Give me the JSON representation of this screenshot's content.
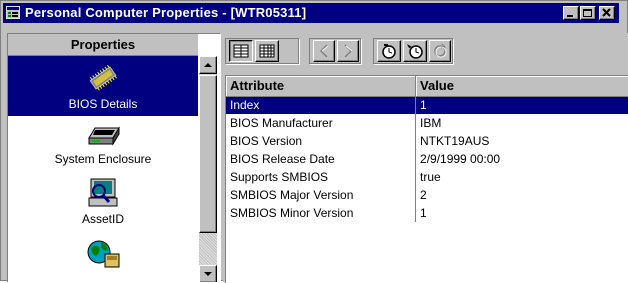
{
  "window": {
    "title": "Personal Computer Properties - [WTR05311]",
    "controls": {
      "minimize_icon": "minimize-icon",
      "maximize_icon": "maximize-icon",
      "close_icon": "close-icon"
    }
  },
  "sidebar": {
    "header": "Properties",
    "items": [
      {
        "label": "BIOS Details",
        "icon": "bios-chip-icon",
        "selected": true
      },
      {
        "label": "System Enclosure",
        "icon": "system-enclosure-icon",
        "selected": false
      },
      {
        "label": "AssetID",
        "icon": "asset-id-icon",
        "selected": false
      },
      {
        "label": "",
        "icon": "network-globe-icon",
        "selected": false
      }
    ]
  },
  "toolbar": {
    "buttons": [
      {
        "name": "details-view-icon",
        "pressed": true
      },
      {
        "name": "grid-view-icon",
        "pressed": false
      },
      {
        "name": "previous-icon",
        "pressed": false,
        "disabled": true
      },
      {
        "name": "next-icon",
        "pressed": false,
        "disabled": true
      },
      {
        "name": "history-icon",
        "pressed": false
      },
      {
        "name": "history-compare-icon",
        "pressed": false
      },
      {
        "name": "refresh-icon",
        "pressed": false,
        "disabled": true
      }
    ]
  },
  "table": {
    "columns": [
      "Attribute",
      "Value"
    ],
    "rows": [
      {
        "attribute": "Index",
        "value": "1",
        "selected": true
      },
      {
        "attribute": "BIOS Manufacturer",
        "value": "IBM",
        "selected": false
      },
      {
        "attribute": "BIOS Version",
        "value": "NTKT19AUS",
        "selected": false
      },
      {
        "attribute": "BIOS Release Date",
        "value": "2/9/1999 00:00",
        "selected": false
      },
      {
        "attribute": "Supports SMBIOS",
        "value": "true",
        "selected": false
      },
      {
        "attribute": "SMBIOS Major Version",
        "value": "2",
        "selected": false
      },
      {
        "attribute": "SMBIOS Minor Version",
        "value": "1",
        "selected": false
      }
    ]
  },
  "colors": {
    "titlebar": "#000080",
    "selection": "#000080",
    "chrome": "#c0c0c0"
  }
}
